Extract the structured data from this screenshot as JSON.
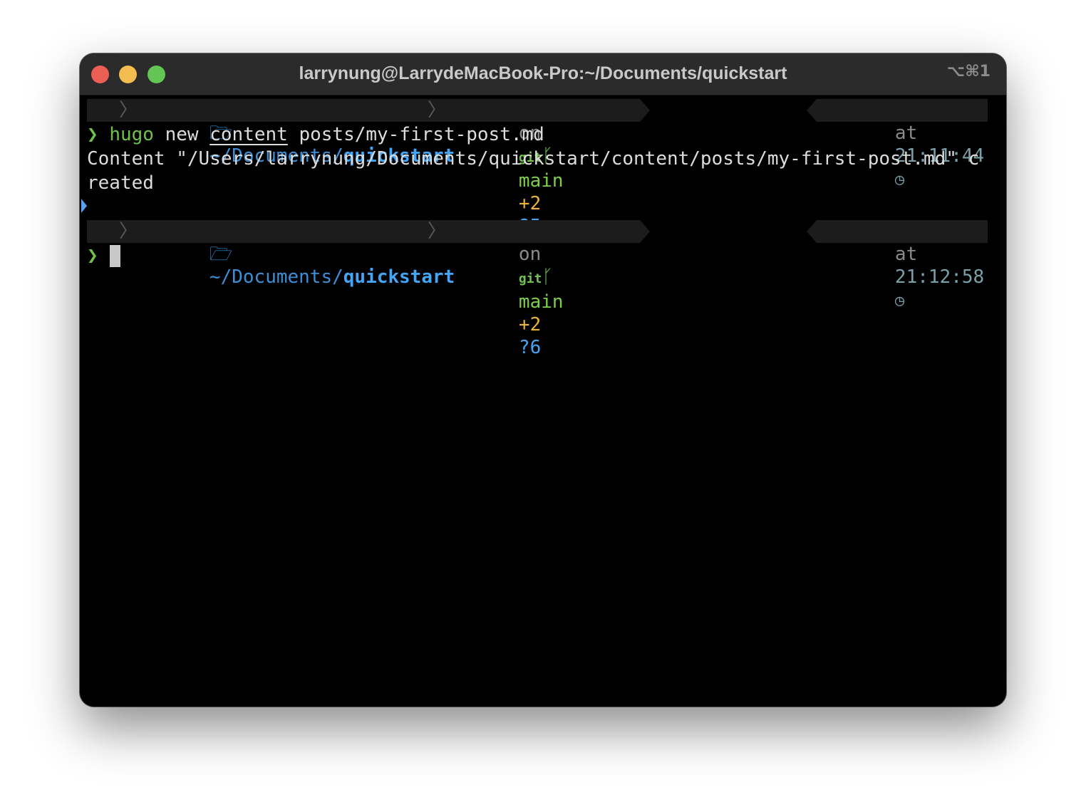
{
  "window": {
    "title": "larrynung@LarrydeMacBook-Pro:~/Documents/quickstart",
    "shortcut": "⌥⌘1"
  },
  "colors": {
    "path": "#42a5f5",
    "branch": "#7ccf4a",
    "staged": "#e8b53c",
    "prompt": "#6fc24a"
  },
  "prompt1": {
    "os_icon": "apple-icon",
    "folder_icon": "folder-icon",
    "path_prefix": "~/Documents/",
    "path_dir": "quickstart",
    "on": "on",
    "vcs": "git",
    "branch": "main",
    "staged": "+2",
    "untracked": "?5",
    "at": "at",
    "time": "21:11:44"
  },
  "command": {
    "symbol": "❯",
    "program": "hugo",
    "sub1": "new",
    "sub2": "content",
    "path": "posts/my-first-post.md"
  },
  "output": {
    "line1": "Content \"/Users/larrynung/Documents/quickstart/content/posts/my-first-post.md\" c",
    "line2": "reated"
  },
  "prompt2": {
    "path_prefix": "~/Documents/",
    "path_dir": "quickstart",
    "on": "on",
    "vcs": "git",
    "branch": "main",
    "staged": "+2",
    "untracked": "?6",
    "at": "at",
    "time": "21:12:58"
  },
  "input": {
    "symbol": "❯",
    "value": ""
  }
}
